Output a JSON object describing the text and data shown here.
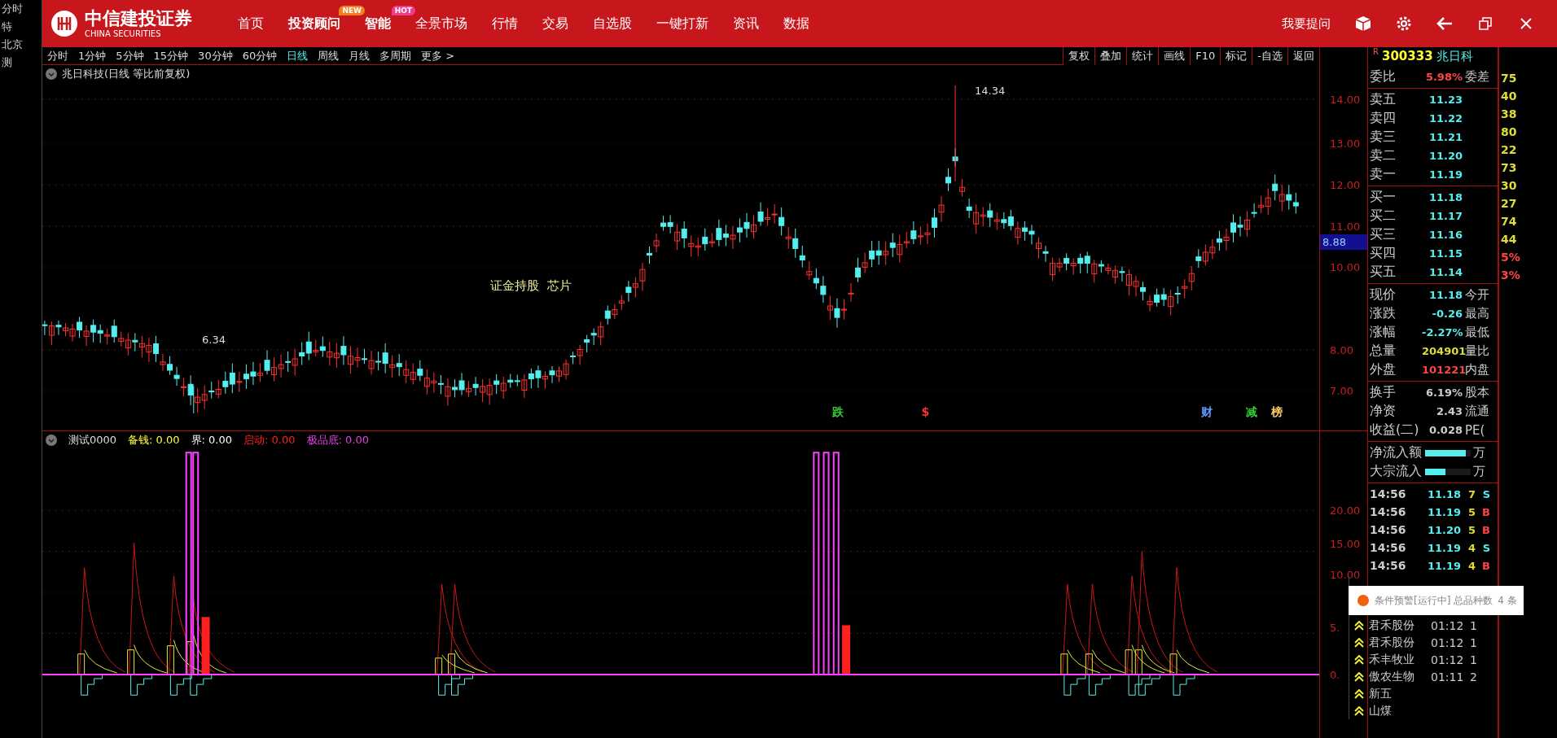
{
  "header": {
    "logo_cn": "中信建投证券",
    "logo_en": "CHINA SECURITIES",
    "ask": "我要提问",
    "nav": [
      {
        "label": "首页",
        "bold": false
      },
      {
        "label": "投资顾问",
        "badge": "NEW",
        "bold": true
      },
      {
        "label": "智能",
        "badge": "HOT",
        "bold": true
      },
      {
        "label": "全景市场",
        "bold": false
      },
      {
        "label": "行情",
        "bold": false
      },
      {
        "label": "交易",
        "bold": false
      },
      {
        "label": "自选股",
        "bold": false
      },
      {
        "label": "一键打新",
        "bold": false
      },
      {
        "label": "资讯",
        "bold": false
      },
      {
        "label": "数据",
        "bold": false
      }
    ]
  },
  "background_windows": {
    "labels": [
      "分时",
      "特",
      "北京",
      "测"
    ]
  },
  "periods": [
    {
      "label": "分时",
      "selected": false
    },
    {
      "label": "1分钟",
      "selected": false
    },
    {
      "label": "5分钟",
      "selected": false
    },
    {
      "label": "15分钟",
      "selected": false
    },
    {
      "label": "30分钟",
      "selected": false
    },
    {
      "label": "60分钟",
      "selected": false
    },
    {
      "label": "日线",
      "selected": true
    },
    {
      "label": "周线",
      "selected": false
    },
    {
      "label": "月线",
      "selected": false
    },
    {
      "label": "多周期",
      "selected": false
    },
    {
      "label": "更多 >",
      "selected": false
    }
  ],
  "tools": [
    "复权",
    "叠加",
    "统计",
    "画线",
    "F10",
    "标记",
    "-自选",
    "返回"
  ],
  "chart": {
    "title": "兆日科技(日线 等比前复权)",
    "high_label": "14.34",
    "low_label": "6.34",
    "concepts": [
      "证金持股",
      "芯片"
    ],
    "price_ticks": [
      "14.00",
      "13.00",
      "12.00",
      "11.00",
      "10.00",
      "8.00",
      "7.00"
    ],
    "price_tag": "8.88",
    "event_marks": [
      {
        "label": "跌",
        "color": "#33cc33"
      },
      {
        "label": "$",
        "color": "#ff3333"
      },
      {
        "label": "财",
        "color": "#6699ff"
      },
      {
        "label": "减",
        "color": "#33cc33"
      },
      {
        "label": "榜",
        "color": "#ffcc66"
      }
    ]
  },
  "indicator": {
    "name": "测试0000",
    "legend": [
      {
        "label": "备钱: 0.00",
        "color": "#ffff33"
      },
      {
        "label": "界: 0.00",
        "color": "#ffffff"
      },
      {
        "label": "启动: 0.00",
        "color": "#ff2020"
      },
      {
        "label": "极品底: 0.00",
        "color": "#e040e0"
      }
    ],
    "ticks": [
      "20.00",
      "15.00",
      "10.00",
      "5.",
      "0."
    ]
  },
  "quote": {
    "flag": "R",
    "code": "300333",
    "name": "兆日科",
    "ratio": {
      "label": "委比",
      "value": "5.98%",
      "extra": "委差"
    },
    "sells": [
      {
        "label": "卖五",
        "price": "11.23"
      },
      {
        "label": "卖四",
        "price": "11.22"
      },
      {
        "label": "卖三",
        "price": "11.21"
      },
      {
        "label": "卖二",
        "price": "11.20"
      },
      {
        "label": "卖一",
        "price": "11.19"
      }
    ],
    "buys": [
      {
        "label": "买一",
        "price": "11.18"
      },
      {
        "label": "买二",
        "price": "11.17"
      },
      {
        "label": "买三",
        "price": "11.16"
      },
      {
        "label": "买四",
        "price": "11.15"
      },
      {
        "label": "买五",
        "price": "11.14"
      }
    ],
    "stats": [
      {
        "label": "现价",
        "value": "11.18",
        "color": "#55eeee",
        "extra": "今开"
      },
      {
        "label": "涨跌",
        "value": "-0.26",
        "color": "#55eeee",
        "extra": "最高"
      },
      {
        "label": "涨幅",
        "value": "-2.27%",
        "color": "#55eeee",
        "extra": "最低"
      },
      {
        "label": "总量",
        "value": "204901",
        "color": "#dddd33",
        "extra": "量比"
      },
      {
        "label": "外盘",
        "value": "101221",
        "color": "#ff4444",
        "extra": "内盘"
      }
    ],
    "finance": [
      {
        "label": "换手",
        "value": "6.19%",
        "extra": "股本"
      },
      {
        "label": "净资",
        "value": "2.43",
        "extra": "流通"
      },
      {
        "label": "收益(二)",
        "value": "0.028",
        "extra": "PE("
      }
    ],
    "flows": [
      {
        "label": "净流入额",
        "level": 0.9,
        "unit": "万"
      },
      {
        "label": "大宗流入",
        "level": 0.45,
        "unit": "万"
      }
    ],
    "ticks": [
      {
        "time": "14:56",
        "price": "11.18",
        "volume": "7",
        "side": "S"
      },
      {
        "time": "14:56",
        "price": "11.19",
        "volume": "5",
        "side": "B"
      },
      {
        "time": "14:56",
        "price": "11.20",
        "volume": "5",
        "side": "B"
      },
      {
        "time": "14:56",
        "price": "11.19",
        "volume": "4",
        "side": "S"
      },
      {
        "time": "14:56",
        "price": "11.19",
        "volume": "4",
        "side": "B"
      }
    ]
  },
  "alert": {
    "title": "条件预警[运行中] 总品种数",
    "count": "4 条",
    "rows": [
      {
        "name": "君禾股份",
        "time": "01:12",
        "n": "1"
      },
      {
        "name": "君禾股份",
        "time": "01:12",
        "n": "1"
      },
      {
        "name": "禾丰牧业",
        "time": "01:12",
        "n": "1"
      },
      {
        "name": "傲农生物",
        "time": "01:11",
        "n": "2"
      },
      {
        "name": "新五"
      },
      {
        "name": "山煤"
      }
    ]
  },
  "side_strip": [
    "75",
    "40",
    "38",
    "80",
    "22",
    "73",
    "30",
    "27",
    "74",
    "44",
    "5%",
    "3%"
  ]
}
